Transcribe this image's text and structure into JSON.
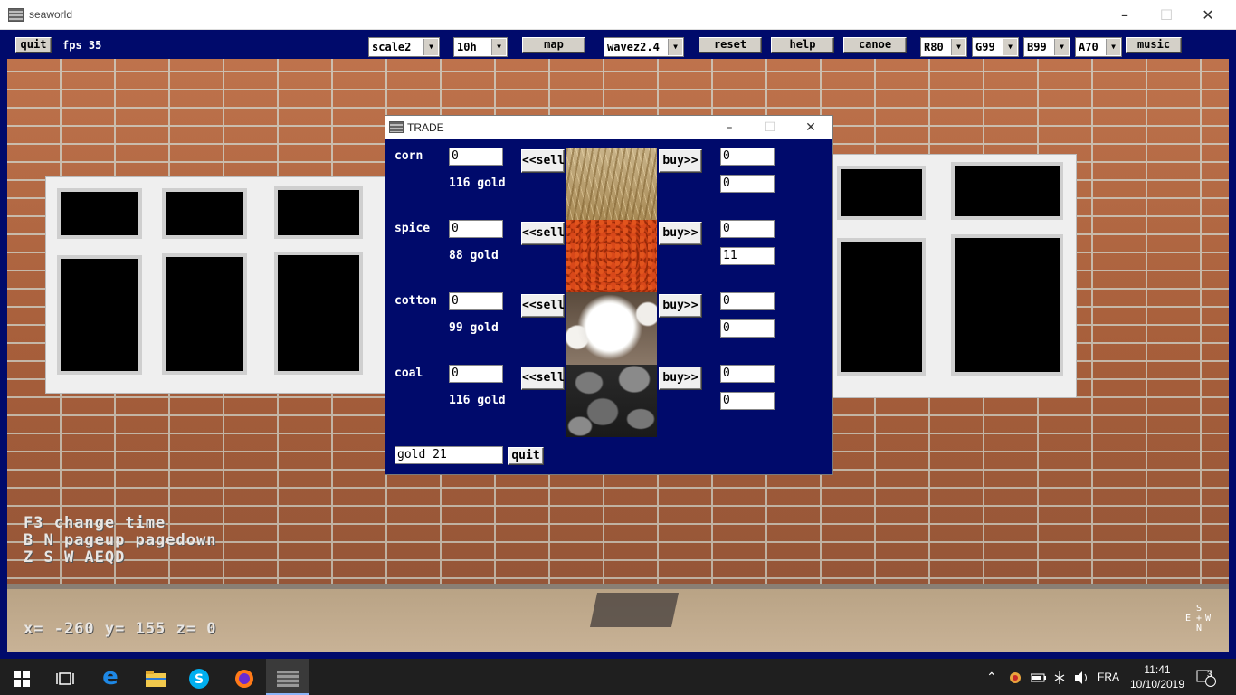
{
  "window": {
    "title": "seaworld"
  },
  "toolbar": {
    "quit_label": "quit",
    "fps_label": "fps 35",
    "scale_value": "scale2",
    "time_value": "10h",
    "map_label": "map",
    "wave_value": "wavez2.4",
    "reset_label": "reset",
    "help_label": "help",
    "canoe_label": "canoe",
    "r_value": "R80",
    "g_value": "G99",
    "b_value": "B99",
    "a_value": "A70",
    "music_label": "music"
  },
  "hud": {
    "line1": "F3 change time",
    "line2": "B N pageup pagedown",
    "line3": "Z S W AEQD",
    "coords": "x= -260 y= 155 z= 0",
    "compass": {
      "n": "N",
      "s": "S",
      "e": "E",
      "w": "W"
    }
  },
  "trade": {
    "title": "TRADE",
    "sell_label": "<<sell",
    "buy_label": "buy>>",
    "goods": [
      {
        "name": "corn",
        "price": "116 gold",
        "sell_qty": "0",
        "buy_qty": "0",
        "stock": "0",
        "image": "corn-image"
      },
      {
        "name": "spice",
        "price": "88 gold",
        "sell_qty": "0",
        "buy_qty": "0",
        "stock": "11",
        "image": "spice-image"
      },
      {
        "name": "cotton",
        "price": "99 gold",
        "sell_qty": "0",
        "buy_qty": "0",
        "stock": "0",
        "image": "cotton-image"
      },
      {
        "name": "coal",
        "price": "116 gold",
        "sell_qty": "0",
        "buy_qty": "0",
        "stock": "0",
        "image": "coal-image"
      }
    ],
    "gold": "gold 21",
    "quit_label": "quit"
  },
  "taskbar": {
    "language": "FRA",
    "time": "11:41",
    "date": "10/10/2019",
    "notifications": "3"
  }
}
